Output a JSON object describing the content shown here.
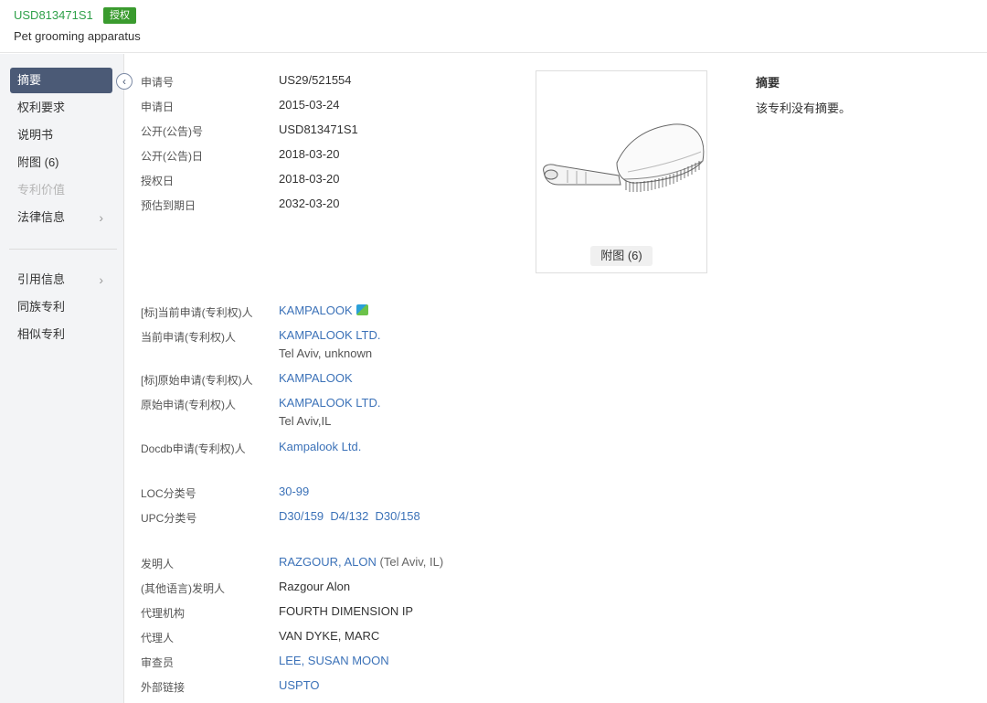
{
  "header": {
    "patent_number": "USD813471S1",
    "status_badge": "授权",
    "title": "Pet grooming apparatus"
  },
  "sidebar": {
    "items": [
      {
        "label": "摘要"
      },
      {
        "label": "权利要求"
      },
      {
        "label": "说明书"
      },
      {
        "label": "附图 (6)"
      },
      {
        "label": "专利价值"
      },
      {
        "label": "法律信息"
      },
      {
        "label": "引用信息"
      },
      {
        "label": "同族专利"
      },
      {
        "label": "相似专利"
      }
    ]
  },
  "fields": {
    "app_no": {
      "label": "申请号",
      "value": "US29/521554"
    },
    "app_date": {
      "label": "申请日",
      "value": "2015-03-24"
    },
    "pub_no": {
      "label": "公开(公告)号",
      "value": "USD813471S1"
    },
    "pub_date": {
      "label": "公开(公告)日",
      "value": "2018-03-20"
    },
    "grant_date": {
      "label": "授权日",
      "value": "2018-03-20"
    },
    "expiry": {
      "label": "预估到期日",
      "value": "2032-03-20"
    },
    "std_current": {
      "label": "[标]当前申请(专利权)人",
      "value": "KAMPALOOK"
    },
    "current": {
      "label": "当前申请(专利权)人",
      "value": "KAMPALOOK LTD.",
      "address": "Tel Aviv, unknown"
    },
    "std_original": {
      "label": "[标]原始申请(专利权)人",
      "value": "KAMPALOOK"
    },
    "original": {
      "label": "原始申请(专利权)人",
      "value": "KAMPALOOK LTD.",
      "address": "Tel Aviv,IL"
    },
    "docdb": {
      "label": "Docdb申请(专利权)人",
      "value": "Kampalook Ltd."
    },
    "loc": {
      "label": "LOC分类号",
      "value": "30-99"
    },
    "upc": {
      "label": "UPC分类号",
      "values": [
        "D30/159",
        "D4/132",
        "D30/158"
      ]
    },
    "inventor": {
      "label": "发明人",
      "value": "RAZGOUR, ALON",
      "location": "(Tel Aviv, IL)"
    },
    "other_inventor": {
      "label": "(其他语言)发明人",
      "value": "Razgour Alon"
    },
    "agency": {
      "label": "代理机构",
      "value": "FOURTH DIMENSION IP"
    },
    "agent": {
      "label": "代理人",
      "value": "VAN DYKE, MARC"
    },
    "examiner": {
      "label": "审查员",
      "value": "LEE, SUSAN MOON"
    },
    "external": {
      "label": "外部链接",
      "value": "USPTO"
    }
  },
  "figure": {
    "button_label": "附图 (6)"
  },
  "abstract": {
    "title": "摘要",
    "text": "该专利没有摘要。"
  },
  "colors": {
    "accent_link": "#3c72b8",
    "active_nav": "#4b5a76",
    "status_green": "#3a9b2e",
    "pn_green": "#2fa04a"
  }
}
